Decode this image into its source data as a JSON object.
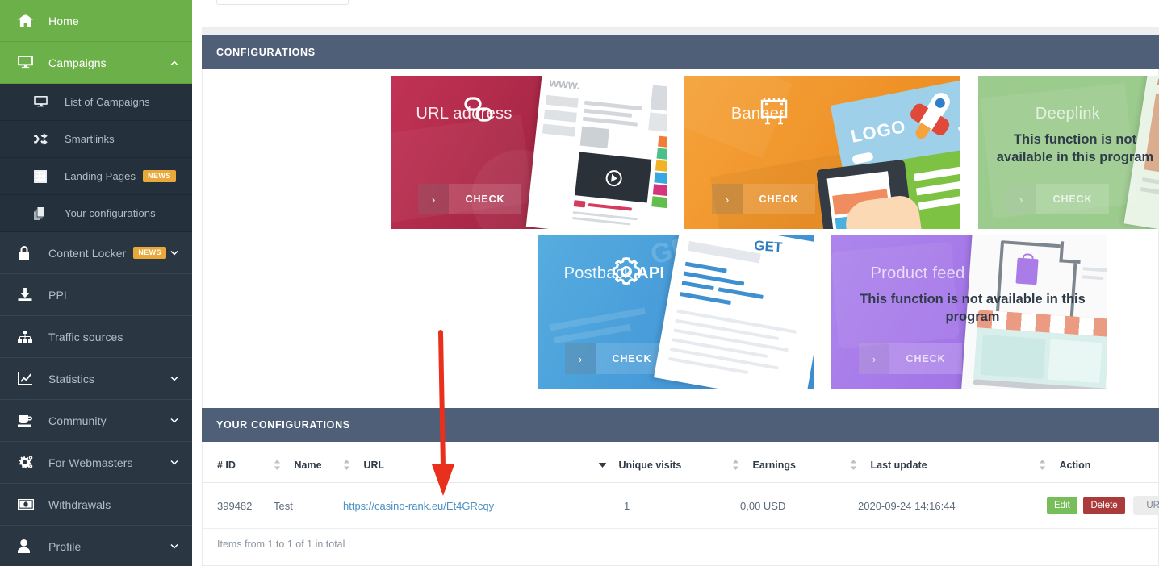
{
  "sidebar": {
    "items": [
      {
        "label": "Home",
        "icon": "home-icon",
        "state": "active",
        "level": "top",
        "badge": null,
        "chevron": null
      },
      {
        "label": "Campaigns",
        "icon": "desktop-icon",
        "state": "active",
        "level": "top",
        "badge": null,
        "chevron": "up"
      },
      {
        "label": "List of Campaigns",
        "icon": "desktop-icon",
        "state": "normal",
        "level": "sub",
        "badge": null,
        "chevron": null
      },
      {
        "label": "Smartlinks",
        "icon": "shuffle-icon",
        "state": "normal",
        "level": "sub",
        "badge": null,
        "chevron": null
      },
      {
        "label": "Landing Pages",
        "icon": "list-alt-icon",
        "state": "normal",
        "level": "sub",
        "badge": "NEWS",
        "chevron": null
      },
      {
        "label": "Your configurations",
        "icon": "copy-icon",
        "state": "normal",
        "level": "sub",
        "badge": null,
        "chevron": null
      },
      {
        "label": "Content Locker",
        "icon": "lock-icon",
        "state": "normal",
        "level": "top",
        "badge": "NEWS",
        "chevron": "down"
      },
      {
        "label": "PPI",
        "icon": "download-icon",
        "state": "normal",
        "level": "top",
        "badge": null,
        "chevron": null
      },
      {
        "label": "Traffic sources",
        "icon": "sitemap-icon",
        "state": "normal",
        "level": "top",
        "badge": null,
        "chevron": null
      },
      {
        "label": "Statistics",
        "icon": "chart-line-icon",
        "state": "normal",
        "level": "top",
        "badge": null,
        "chevron": "down"
      },
      {
        "label": "Community",
        "icon": "coffee-icon",
        "state": "normal",
        "level": "top",
        "badge": null,
        "chevron": "down"
      },
      {
        "label": "For Webmasters",
        "icon": "cogs-icon",
        "state": "normal",
        "level": "top",
        "badge": null,
        "chevron": "down"
      },
      {
        "label": "Withdrawals",
        "icon": "money-icon",
        "state": "normal",
        "level": "top",
        "badge": null,
        "chevron": null
      },
      {
        "label": "Profile",
        "icon": "user-icon",
        "state": "normal",
        "level": "top",
        "badge": null,
        "chevron": "down"
      }
    ]
  },
  "configurations_panel": {
    "title": "CONFIGURATIONS",
    "cards": [
      {
        "id": "url-address",
        "title": "URL address",
        "title_html": "URL address",
        "button_label": "CHECK",
        "arrow": "›",
        "available": true,
        "notice": null,
        "color": "#b32b4a",
        "icon": "link-icon"
      },
      {
        "id": "banner",
        "title": "Banner",
        "title_html": "Banner",
        "button_label": "CHECK",
        "arrow": "›",
        "available": true,
        "notice": null,
        "color": "#f0992e",
        "icon": "banner-icon"
      },
      {
        "id": "deeplink",
        "title": "Deeplink",
        "title_html": "Deeplink",
        "button_label": "CHECK",
        "arrow": "›",
        "available": false,
        "notice": "This function is not available in this program",
        "color": "#9ccb8e",
        "icon": null
      },
      {
        "id": "postback-api",
        "title": "Postback API",
        "title_html": "Postback <b>API</b>",
        "button_label": "CHECK",
        "arrow": "›",
        "available": true,
        "notice": null,
        "color": "#4aa3e0",
        "icon": "gear-icon"
      },
      {
        "id": "product-feed",
        "title": "Product feed",
        "title_html": "Product feed",
        "button_label": "CHECK",
        "arrow": "›",
        "available": false,
        "notice": "This function is not available in this program",
        "color": "#a478e8",
        "icon": null
      }
    ]
  },
  "your_configurations_panel": {
    "title": "YOUR CONFIGURATIONS",
    "columns": [
      {
        "label": "# ID",
        "sort": "both"
      },
      {
        "label": "Name",
        "sort": "both"
      },
      {
        "label": "URL",
        "sort": "both"
      },
      {
        "label": "Unique visits",
        "sort": "desc"
      },
      {
        "label": "Earnings",
        "sort": "both"
      },
      {
        "label": "Last update",
        "sort": "both"
      },
      {
        "label": "Action",
        "sort": "both"
      }
    ],
    "rows": [
      {
        "id": "399482",
        "name": "Test",
        "url": "https://casino-rank.eu/Et4GRcqy",
        "unique_visits": "1",
        "earnings": "0,00 USD",
        "last_update": "2020-09-24 14:16:44",
        "actions": {
          "edit": "Edit",
          "delete": "Delete",
          "generator": "URL generator"
        }
      }
    ],
    "footer": "Items from 1 to 1 of 1 in total"
  },
  "annotation": {
    "type": "arrow",
    "color": "#e8301c",
    "direction": "down",
    "points_at": "url-cell"
  },
  "colors": {
    "sidebar_bg": "#2b3643",
    "sidebar_sub_bg": "#25303d",
    "accent_green": "#6cb04a",
    "panel_header": "#4f5f77",
    "badge_orange": "#e9a83a",
    "link_blue": "#4a90c4",
    "btn_edit": "#77bd5a",
    "btn_delete": "#ab3b3b"
  }
}
